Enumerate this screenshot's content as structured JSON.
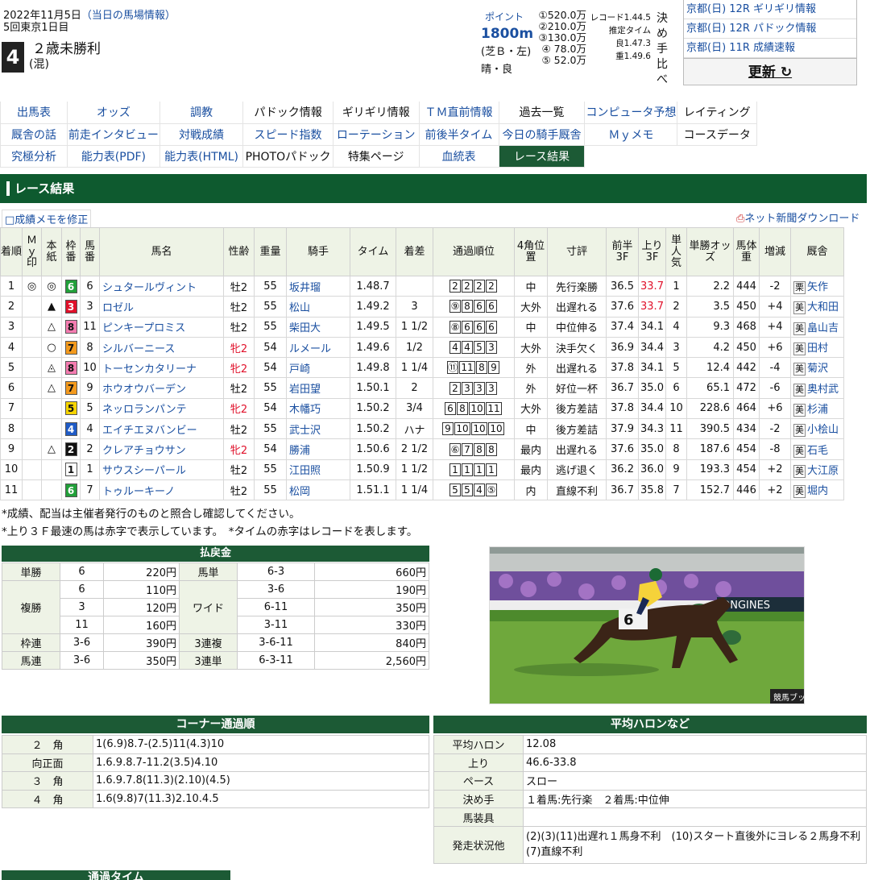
{
  "header": {
    "date": "2022年11月5日",
    "date_note": "（当日の馬場情報）",
    "meeting": "5回東京1日目",
    "race_number": "4",
    "race_name": "２歳未勝利",
    "race_condition": "(混)",
    "points_label": "ポイント",
    "distance": "1800m",
    "course": "(芝Ｂ・左)",
    "weather": "晴・良",
    "prizes": [
      "①520.0万",
      "②210.0万",
      "③130.0万",
      "④ 78.0万",
      "⑤ 52.0万"
    ],
    "records": [
      "レコード1.44.5",
      "推定タイム",
      "良1.47.3",
      "重1.49.6"
    ],
    "decide_label": "決め手比べ"
  },
  "news": [
    "京都(日) 12R ギリギリ情報",
    "京都(日) 12R パドック情報",
    "京都(日) 11R 成績速報"
  ],
  "update_button": "更新 ↻",
  "menu": [
    [
      "出馬表",
      "オッズ",
      "調教",
      "パドック情報",
      "ギリギリ情報",
      "ＴＭ直前情報",
      "過去一覧",
      "コンピュータ予想",
      "レイティング"
    ],
    [
      "厩舎の話",
      "前走インタビュー",
      "対戦成績",
      "スピード指数",
      "ローテーション",
      "前後半タイム",
      "今日の騎手厩舎",
      "Ｍｙメモ",
      "コースデータ"
    ],
    [
      "究極分析",
      "能力表(PDF)",
      "能力表(HTML)",
      "PHOTOパドック",
      "特集ページ",
      "血統表",
      "レース結果"
    ]
  ],
  "section_title": "レース結果",
  "memo_link": "□成績メモを修正",
  "download_link": "ネット新聞ダウンロード",
  "columns": [
    "着順",
    "Ｍｙ印",
    "本紙",
    "枠番",
    "馬番",
    "馬名",
    "性齢",
    "重量",
    "騎手",
    "タイム",
    "着差",
    "通過順位",
    "4角位置",
    "寸評",
    "前半3F",
    "上り3F",
    "単人気",
    "単勝オッズ",
    "馬体重",
    "増減",
    "厩舎"
  ],
  "rows": [
    {
      "rank": "1",
      "my": "◎",
      "paper": "◎",
      "waku": "6",
      "uma": "6",
      "name": "シュタールヴィント",
      "sex": "牡2",
      "weight": "55",
      "jockey": "坂井瑠",
      "time": "1.48.7",
      "margin": "",
      "passing": [
        "2",
        "2",
        "2",
        "2"
      ],
      "corner": "中",
      "comment": "先行楽勝",
      "f3": "36.5",
      "l3": "33.7",
      "pop": "1",
      "odds": "2.2",
      "bw": "444",
      "diff": "-2",
      "region": "栗",
      "trainer": "矢作"
    },
    {
      "rank": "2",
      "my": "",
      "paper": "▲",
      "waku": "3",
      "uma": "3",
      "name": "ロゼル",
      "sex": "牡2",
      "weight": "55",
      "jockey": "松山",
      "time": "1.49.2",
      "margin": "3",
      "passing": [
        "⑨",
        "8",
        "6",
        "6"
      ],
      "corner": "大外",
      "comment": "出遅れる",
      "f3": "37.6",
      "l3": "33.7",
      "pop": "2",
      "odds": "3.5",
      "bw": "450",
      "diff": "+4",
      "region": "美",
      "trainer": "大和田"
    },
    {
      "rank": "3",
      "my": "",
      "paper": "△",
      "waku": "8",
      "uma": "11",
      "name": "ピンキープロミス",
      "sex": "牡2",
      "weight": "55",
      "jockey": "柴田大",
      "time": "1.49.5",
      "margin": "1 1/2",
      "passing": [
        "⑧",
        "6",
        "6",
        "6"
      ],
      "corner": "中",
      "comment": "中位伸る",
      "f3": "37.4",
      "l3": "34.1",
      "pop": "4",
      "odds": "9.3",
      "bw": "468",
      "diff": "+4",
      "region": "美",
      "trainer": "畠山吉"
    },
    {
      "rank": "4",
      "my": "",
      "paper": "○",
      "waku": "7",
      "uma": "8",
      "name": "シルバーニース",
      "sex": "牝2",
      "weight": "54",
      "jockey": "ルメール",
      "time": "1.49.6",
      "margin": "1/2",
      "passing": [
        "4",
        "4",
        "5",
        "3"
      ],
      "corner": "大外",
      "comment": "決手欠く",
      "f3": "36.9",
      "l3": "34.4",
      "pop": "3",
      "odds": "4.2",
      "bw": "450",
      "diff": "+6",
      "region": "美",
      "trainer": "田村"
    },
    {
      "rank": "5",
      "my": "",
      "paper": "◬",
      "waku": "8",
      "uma": "10",
      "name": "トーセンカタリーナ",
      "sex": "牝2",
      "weight": "54",
      "jockey": "戸崎",
      "time": "1.49.8",
      "margin": "1 1/4",
      "passing": [
        "⑪",
        "11",
        "8",
        "9"
      ],
      "corner": "外",
      "comment": "出遅れる",
      "f3": "37.8",
      "l3": "34.1",
      "pop": "5",
      "odds": "12.4",
      "bw": "442",
      "diff": "-4",
      "region": "美",
      "trainer": "菊沢"
    },
    {
      "rank": "6",
      "my": "",
      "paper": "△",
      "waku": "7",
      "uma": "9",
      "name": "ホウオウバーデン",
      "sex": "牡2",
      "weight": "55",
      "jockey": "岩田望",
      "time": "1.50.1",
      "margin": "2",
      "passing": [
        "2",
        "3",
        "3",
        "3"
      ],
      "corner": "外",
      "comment": "好位一杯",
      "f3": "36.7",
      "l3": "35.0",
      "pop": "6",
      "odds": "65.1",
      "bw": "472",
      "diff": "-6",
      "region": "美",
      "trainer": "奥村武"
    },
    {
      "rank": "7",
      "my": "",
      "paper": "",
      "waku": "5",
      "uma": "5",
      "name": "ネッロランパンテ",
      "sex": "牝2",
      "weight": "54",
      "jockey": "木幡巧",
      "time": "1.50.2",
      "margin": "3/4",
      "passing": [
        "6",
        "8",
        "10",
        "11"
      ],
      "corner": "大外",
      "comment": "後方差詰",
      "f3": "37.8",
      "l3": "34.4",
      "pop": "10",
      "odds": "228.6",
      "bw": "464",
      "diff": "+6",
      "region": "美",
      "trainer": "杉浦"
    },
    {
      "rank": "8",
      "my": "",
      "paper": "",
      "waku": "4",
      "uma": "4",
      "name": "エイチエヌバンビー",
      "sex": "牡2",
      "weight": "55",
      "jockey": "武士沢",
      "time": "1.50.2",
      "margin": "ハナ",
      "passing": [
        "9",
        "10",
        "10",
        "10"
      ],
      "corner": "中",
      "comment": "後方差詰",
      "f3": "37.9",
      "l3": "34.3",
      "pop": "11",
      "odds": "390.5",
      "bw": "434",
      "diff": "-2",
      "region": "美",
      "trainer": "小桧山"
    },
    {
      "rank": "9",
      "my": "",
      "paper": "△",
      "waku": "2",
      "uma": "2",
      "name": "クレアチョウサン",
      "sex": "牝2",
      "weight": "54",
      "jockey": "勝浦",
      "time": "1.50.6",
      "margin": "2 1/2",
      "passing": [
        "⑥",
        "7",
        "8",
        "8"
      ],
      "corner": "最内",
      "comment": "出遅れる",
      "f3": "37.6",
      "l3": "35.0",
      "pop": "8",
      "odds": "187.6",
      "bw": "454",
      "diff": "-8",
      "region": "美",
      "trainer": "石毛"
    },
    {
      "rank": "10",
      "my": "",
      "paper": "",
      "waku": "1",
      "uma": "1",
      "name": "サウスシーパール",
      "sex": "牡2",
      "weight": "55",
      "jockey": "江田照",
      "time": "1.50.9",
      "margin": "1 1/2",
      "passing": [
        "1",
        "1",
        "1",
        "1"
      ],
      "corner": "最内",
      "comment": "逃げ退く",
      "f3": "36.2",
      "l3": "36.0",
      "pop": "9",
      "odds": "193.3",
      "bw": "454",
      "diff": "+2",
      "region": "美",
      "trainer": "大江原"
    },
    {
      "rank": "11",
      "my": "",
      "paper": "",
      "waku": "6",
      "uma": "7",
      "name": "トゥルーキーノ",
      "sex": "牡2",
      "weight": "55",
      "jockey": "松岡",
      "time": "1.51.1",
      "margin": "1 1/4",
      "passing": [
        "5",
        "5",
        "4",
        "⑤"
      ],
      "corner": "内",
      "comment": "直線不利",
      "f3": "36.7",
      "l3": "35.8",
      "pop": "7",
      "odds": "152.7",
      "bw": "446",
      "diff": "+2",
      "region": "美",
      "trainer": "堀内"
    }
  ],
  "notes": [
    "*成績、配当は主催者発行のものと照合し確認してください。",
    "*上り３Ｆ最速の馬は赤字で表示しています。　*タイムの赤字はレコードを表します。"
  ],
  "payout": {
    "title": "払戻金",
    "win": {
      "label": "単勝",
      "combos": [
        "6"
      ],
      "amounts": [
        "220円"
      ]
    },
    "place": {
      "label": "複勝",
      "combos": [
        "6",
        "3",
        "11"
      ],
      "amounts": [
        "110円",
        "120円",
        "160円"
      ]
    },
    "bracket": {
      "label": "枠連",
      "combos": [
        "3-6"
      ],
      "amounts": [
        "390円"
      ]
    },
    "quinella": {
      "label": "馬連",
      "combos": [
        "3-6"
      ],
      "amounts": [
        "350円"
      ]
    },
    "exacta": {
      "label": "馬単",
      "combos": [
        "6-3"
      ],
      "amounts": [
        "660円"
      ]
    },
    "wide": {
      "label": "ワイド",
      "combos": [
        "3-6",
        "6-11",
        "3-11"
      ],
      "amounts": [
        "190円",
        "350円",
        "330円"
      ]
    },
    "trio": {
      "label": "3連複",
      "combos": [
        "3-6-11"
      ],
      "amounts": [
        "840円"
      ]
    },
    "trifecta": {
      "label": "3連単",
      "combos": [
        "6-3-11"
      ],
      "amounts": [
        "2,560円"
      ]
    }
  },
  "photo": {
    "number": "6",
    "banner": "ONGINES",
    "credit": "競馬ブック"
  },
  "corners": {
    "title": "コーナー通過順",
    "rows": [
      {
        "label": "２　角",
        "value": "1(6.9)8.7-(2.5)11(4.3)10"
      },
      {
        "label": "向正面",
        "value": "1.6.9.8.7-11.2(3.5)4.10"
      },
      {
        "label": "３　角",
        "value": "1.6.9.7.8(11.3)(2.10)(4.5)"
      },
      {
        "label": "４　角",
        "value": "1.6(9.8)7(11.3)2.10.4.5"
      }
    ]
  },
  "average": {
    "title": "平均ハロンなど",
    "rows": [
      {
        "label": "平均ハロン",
        "value": "12.08"
      },
      {
        "label": "上り",
        "value": "46.6-33.8"
      },
      {
        "label": "ペース",
        "value": "スロー"
      },
      {
        "label": "決め手",
        "value": "１着馬:先行楽　２着馬:中位伸"
      },
      {
        "label": "馬装具",
        "value": ""
      },
      {
        "label": "発走状況他",
        "value": "(2)(3)(11)出遅れ１馬身不利　(10)スタート直後外にヨレる２馬身不利　(7)直線不利"
      }
    ]
  },
  "time_title": "通過タイム",
  "waku_colors": {
    "1": [
      "#ffffff",
      "#111111"
    ],
    "2": [
      "#111111",
      "#ffffff"
    ],
    "3": [
      "#e0102a",
      "#ffffff"
    ],
    "4": [
      "#1f5bc6",
      "#ffffff"
    ],
    "5": [
      "#f6d400",
      "#111111"
    ],
    "6": [
      "#22a03a",
      "#ffffff"
    ],
    "7": [
      "#f39a1e",
      "#111111"
    ],
    "8": [
      "#f47cb0",
      "#111111"
    ]
  },
  "highlight": {
    "red": "#e0102a",
    "green": "#0e5a2f"
  }
}
